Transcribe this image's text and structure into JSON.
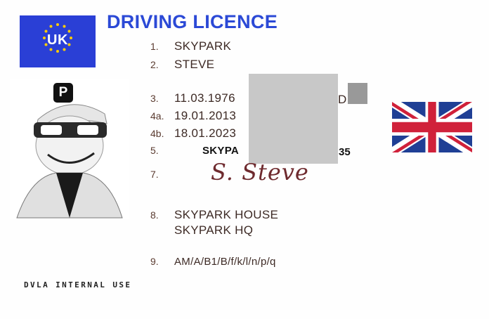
{
  "eu_flag": {
    "country_code": "UK",
    "background": "#2a3fd6",
    "star_color": "#ffcc00"
  },
  "header": {
    "title": "DRIVING LICENCE",
    "title_color": "#2b49d6"
  },
  "fields": [
    {
      "num": "1.",
      "value": "SKYPARK"
    },
    {
      "num": "2.",
      "value": "STEVE"
    },
    {
      "num": "3.",
      "value": "11.03.1976"
    },
    {
      "num": "4a.",
      "value": "19.01.2013"
    },
    {
      "num": "4b.",
      "value": "18.01.2023"
    },
    {
      "num": "5.",
      "value": "SKYPA"
    },
    {
      "num": "7.",
      "value": ""
    },
    {
      "num": "8.",
      "value": "SKYPARK HOUSE"
    },
    {
      "num": "9.",
      "value": "AM/A/B1/B/f/k/l/n/p/q"
    }
  ],
  "field_3_suffix": "D",
  "field_5_suffix": "35",
  "address_line2": "SKYPARK HQ",
  "signature": "S. Steve",
  "photo": {
    "badge_letter": "P"
  },
  "footer": {
    "label": "DVLA INTERNAL USE"
  },
  "flag": {
    "name": "union-jack",
    "blue": "#1f3f95",
    "red": "#d0213a"
  }
}
